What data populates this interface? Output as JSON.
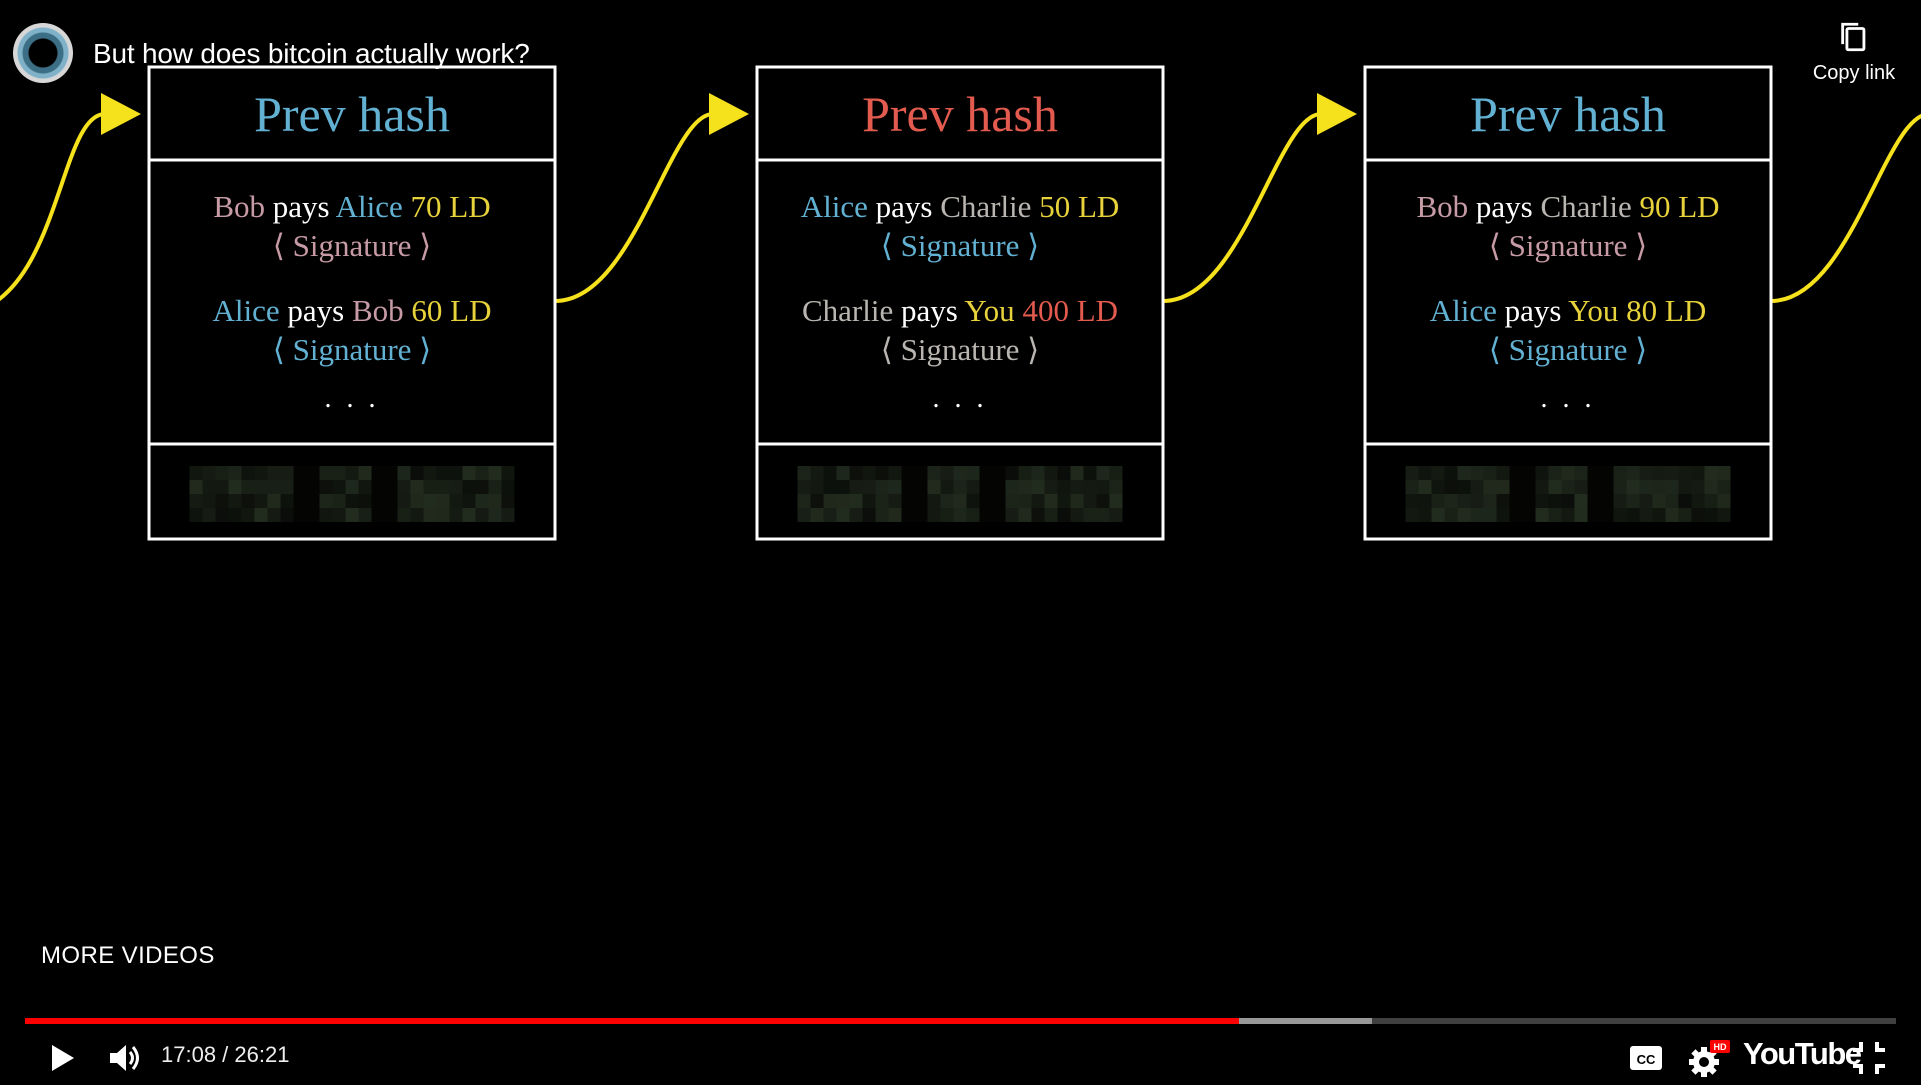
{
  "player": {
    "title": "But how does bitcoin actually work?",
    "copy_link_label": "Copy link",
    "more_videos_label": "MORE VIDEOS",
    "time": "17:08 / 26:21",
    "progress_played": 0.649,
    "progress_buffered": 0.72,
    "youtube_logo": "YouTube",
    "hd_badge": "HD"
  },
  "colors": {
    "pink": "#c79ba6",
    "blue": "#62b1d2",
    "yellow": "#e8d23b",
    "red": "#e35b4f",
    "gray": "#b9b5b0",
    "white": "#ffffff",
    "arrow": "#f6e11d",
    "progress_red": "#ff0000"
  },
  "icons": {
    "copy": "copy-icon",
    "play": "play-icon",
    "volume": "volume-icon",
    "cc": "closed-captions-icon",
    "settings": "gear-icon",
    "exit_fullscreen": "exit-fullscreen-icon"
  },
  "blocks": [
    {
      "header": "Prev hash",
      "header_color": "blue",
      "transactions": [
        {
          "parts": [
            {
              "text": "Bob",
              "color": "pink"
            },
            {
              "text": "pays",
              "color": "white"
            },
            {
              "text": "Alice",
              "color": "blue"
            },
            {
              "text": "70 LD",
              "color": "yellow"
            }
          ],
          "signature": "⟨ Signature ⟩",
          "signature_color": "pink"
        },
        {
          "parts": [
            {
              "text": "Alice",
              "color": "blue"
            },
            {
              "text": "pays",
              "color": "white"
            },
            {
              "text": "Bob",
              "color": "pink"
            },
            {
              "text": "60 LD",
              "color": "yellow"
            }
          ],
          "signature": "⟨ Signature ⟩",
          "signature_color": "blue"
        }
      ],
      "ellipsis": ". . ."
    },
    {
      "header": "Prev hash",
      "header_color": "red",
      "transactions": [
        {
          "parts": [
            {
              "text": "Alice",
              "color": "blue"
            },
            {
              "text": "pays",
              "color": "white"
            },
            {
              "text": "Charlie",
              "color": "gray"
            },
            {
              "text": "50 LD",
              "color": "yellow"
            }
          ],
          "signature": "⟨ Signature ⟩",
          "signature_color": "blue"
        },
        {
          "parts": [
            {
              "text": "Charlie",
              "color": "gray"
            },
            {
              "text": "pays",
              "color": "white"
            },
            {
              "text": "You",
              "color": "yellow"
            },
            {
              "text": "400 LD",
              "color": "red"
            }
          ],
          "signature": "⟨ Signature ⟩",
          "signature_color": "gray"
        }
      ],
      "ellipsis": ". . ."
    },
    {
      "header": "Prev hash",
      "header_color": "blue",
      "transactions": [
        {
          "parts": [
            {
              "text": "Bob",
              "color": "pink"
            },
            {
              "text": "pays",
              "color": "white"
            },
            {
              "text": "Charlie",
              "color": "gray"
            },
            {
              "text": "90 LD",
              "color": "yellow"
            }
          ],
          "signature": "⟨ Signature ⟩",
          "signature_color": "pink"
        },
        {
          "parts": [
            {
              "text": "Alice",
              "color": "blue"
            },
            {
              "text": "pays",
              "color": "white"
            },
            {
              "text": "You",
              "color": "yellow"
            },
            {
              "text": "80 LD",
              "color": "yellow"
            }
          ],
          "signature": "⟨ Signature ⟩",
          "signature_color": "blue"
        }
      ],
      "ellipsis": ". . ."
    }
  ]
}
